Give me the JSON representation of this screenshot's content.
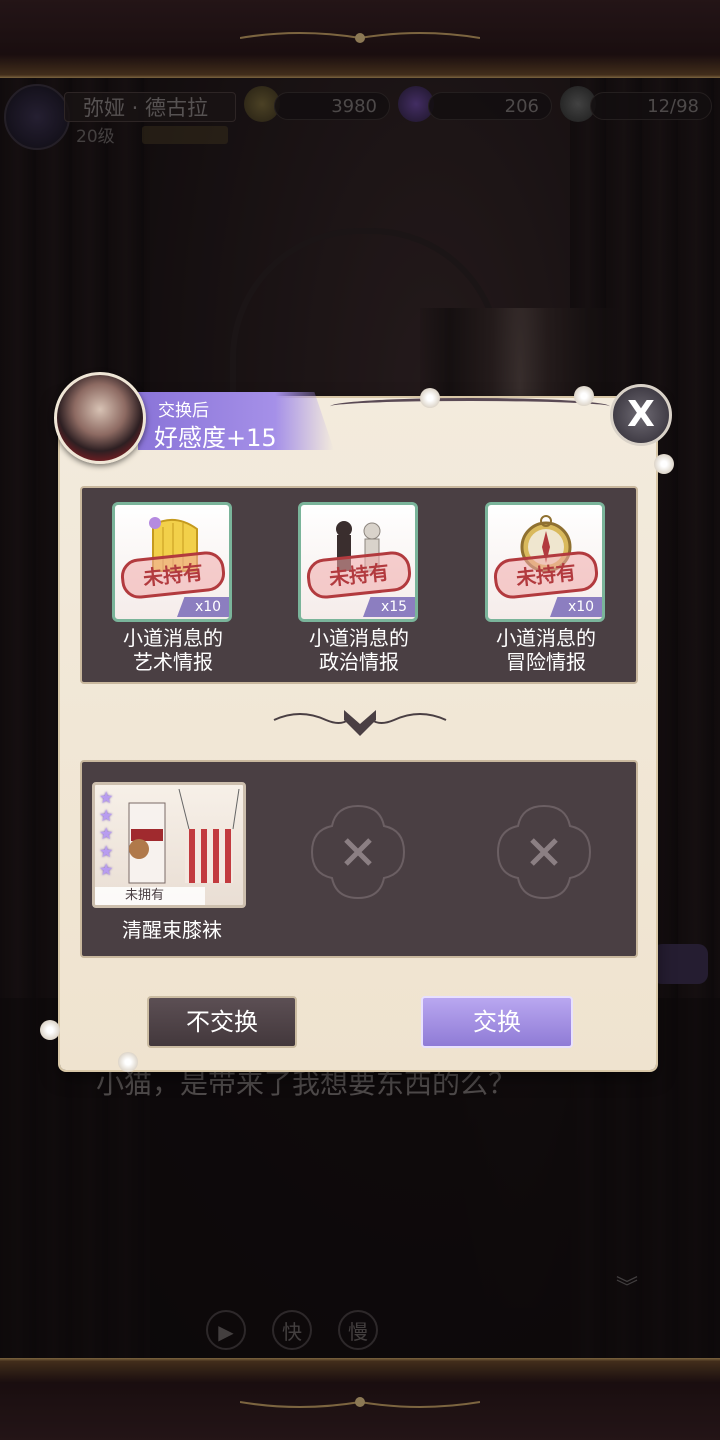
{
  "player": {
    "name": "弥娅 · 德古拉",
    "level": "20级"
  },
  "resources": {
    "gold": "3980",
    "gems": "206",
    "stamina": "12/98"
  },
  "dialog": {
    "text": "小猫，是带来了我想要东西的么？"
  },
  "controls": {
    "auto_icon": "play-icon",
    "fast": "快",
    "slow": "慢"
  },
  "modal": {
    "ribbon_line1": "交换后",
    "ribbon_line2": "好感度+15",
    "close": "X",
    "items": [
      {
        "name_line1": "小道消息的",
        "name_line2": "艺术情报",
        "stamp": "未持有",
        "qty": "x10",
        "icon": "harp-icon"
      },
      {
        "name_line1": "小道消息的",
        "name_line2": "政治情报",
        "stamp": "未持有",
        "qty": "x15",
        "icon": "chess-icon"
      },
      {
        "name_line1": "小道消息的",
        "name_line2": "冒险情报",
        "stamp": "未持有",
        "qty": "x10",
        "icon": "compass-icon"
      }
    ],
    "reward": {
      "name": "清醒束膝袜",
      "owned_label": "未拥有",
      "stars": 5
    },
    "cancel_label": "不交换",
    "confirm_label": "交换"
  },
  "colors": {
    "accent_purple": "#9d88e4",
    "panel_dark": "#4a3f43",
    "parchment": "#f1e7d5",
    "stamp_red": "#b23a3e"
  }
}
